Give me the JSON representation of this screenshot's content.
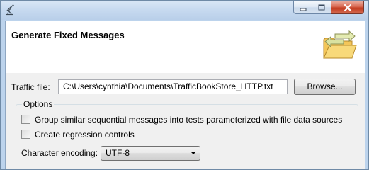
{
  "dialog": {
    "title": "Generate Fixed Messages"
  },
  "traffic": {
    "label": "Traffic file:",
    "value": "C:\\Users\\cynthia\\Documents\\TrafficBookStore_HTTP.txt",
    "browse_label": "Browse..."
  },
  "options": {
    "legend": "Options",
    "group_similar": {
      "label": "Group similar sequential messages into tests parameterized with file data sources",
      "checked": false
    },
    "regression": {
      "label": "Create regression controls",
      "checked": false
    },
    "encoding": {
      "label": "Character encoding:",
      "selected": "UTF-8"
    }
  },
  "icons": {
    "app": "satellite-dish-icon",
    "banner": "folder-exchange-icon",
    "minimize": "minimize-icon",
    "maximize": "maximize-icon",
    "close": "close-icon",
    "dropdown": "chevron-down-icon"
  },
  "colors": {
    "close_button": "#c9432a",
    "window_frame": "#bcd3ec",
    "dialog_background": "#f0f0f0",
    "folder": "#f3c65a",
    "arrows": "#d9e2a0"
  }
}
